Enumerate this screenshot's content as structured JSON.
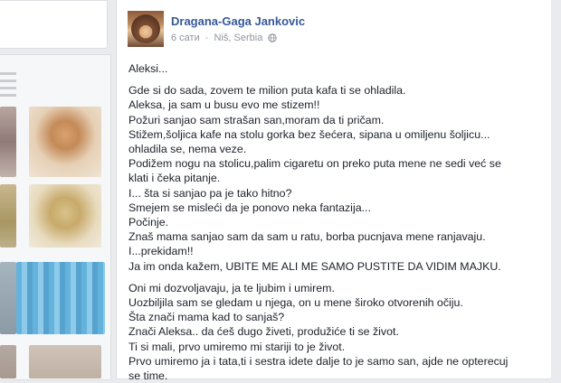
{
  "post": {
    "author": "Dragana-Gaga Jankovic",
    "time": "6 сати",
    "separator": "·",
    "location": "Niš, Serbia",
    "privacy_icon": "globe-icon",
    "paragraphs": [
      [
        "Aleksi..."
      ],
      [
        "Gde si do sada, zovem te milion puta kafa ti se ohladila.",
        "Aleksa, ja sam u busu evo me stizem!!",
        "Požuri sanjao sam strašan san,moram da ti pričam.",
        "Stižem,šoljica kafe na stolu gorka bez šećera, sipana u omiljenu šoljicu...",
        "ohladila se, nema veze.",
        "Podižem nogu na stolicu,palim cigaretu on preko puta mene ne sedi već se",
        "klati i čeka pitanje.",
        "I... šta si sanjao pa je tako hitno?",
        "Smejem se misleći da je ponovo neka fantazija...",
        "Počinje.",
        "Znaš mama sanjao sam da sam u ratu, borba pucnjava mene ranjavaju.",
        "I...prekidam!!",
        "Ja im onda kažem, UBITE ME ALI ME SAMO PUSTITE DA VIDIM MAJKU."
      ],
      [
        "Oni mi dozvoljavaju, ja te ljubim i umirem.",
        "Uozbiljila sam se gledam u njega, on u mene široko otvorenih očiju.",
        "Šta znači mama kad to sanjaš?",
        "Znači Aleksa.. da ćeš dugo živeti, produžiće ti se život.",
        "Ti si mali, prvo umiremo mi stariji to je život.",
        "Prvo umiremo ja i tata,ti i sestra idete dalje to je samo san, ajde ne opterecuj",
        "se time."
      ]
    ]
  }
}
